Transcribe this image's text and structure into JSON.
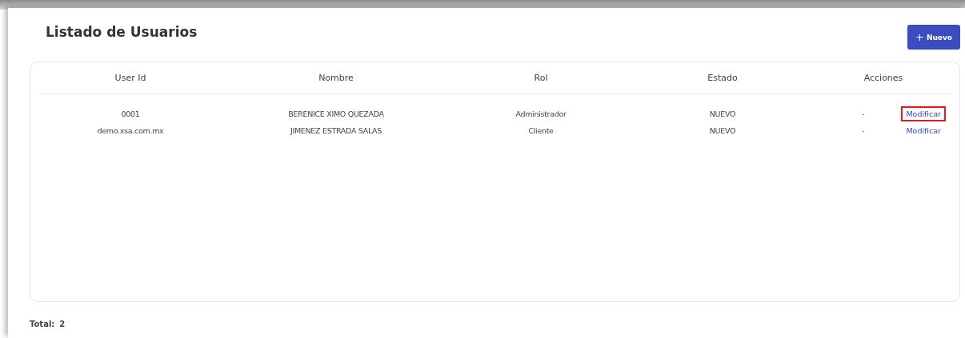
{
  "title": "Listado de Usuarios",
  "new_button": {
    "icon": "+",
    "label": "Nuevo"
  },
  "table": {
    "columns": [
      "User Id",
      "Nombre",
      "Rol",
      "Estado",
      "Acciones"
    ],
    "rows": [
      {
        "user_id": "0001",
        "nombre": "BERENICE XIMO QUEZADA",
        "rol": "Administrador",
        "estado": "NUEVO",
        "dash": "-",
        "action": "Modificar",
        "highlighted": true
      },
      {
        "user_id": "demo.xsa.com.mx",
        "nombre": "JIMENEZ ESTRADA SALAS",
        "rol": "Cliente",
        "estado": "NUEVO",
        "dash": "-",
        "action": "Modificar",
        "highlighted": false
      }
    ]
  },
  "total": {
    "label": "Total:",
    "value": "2"
  }
}
